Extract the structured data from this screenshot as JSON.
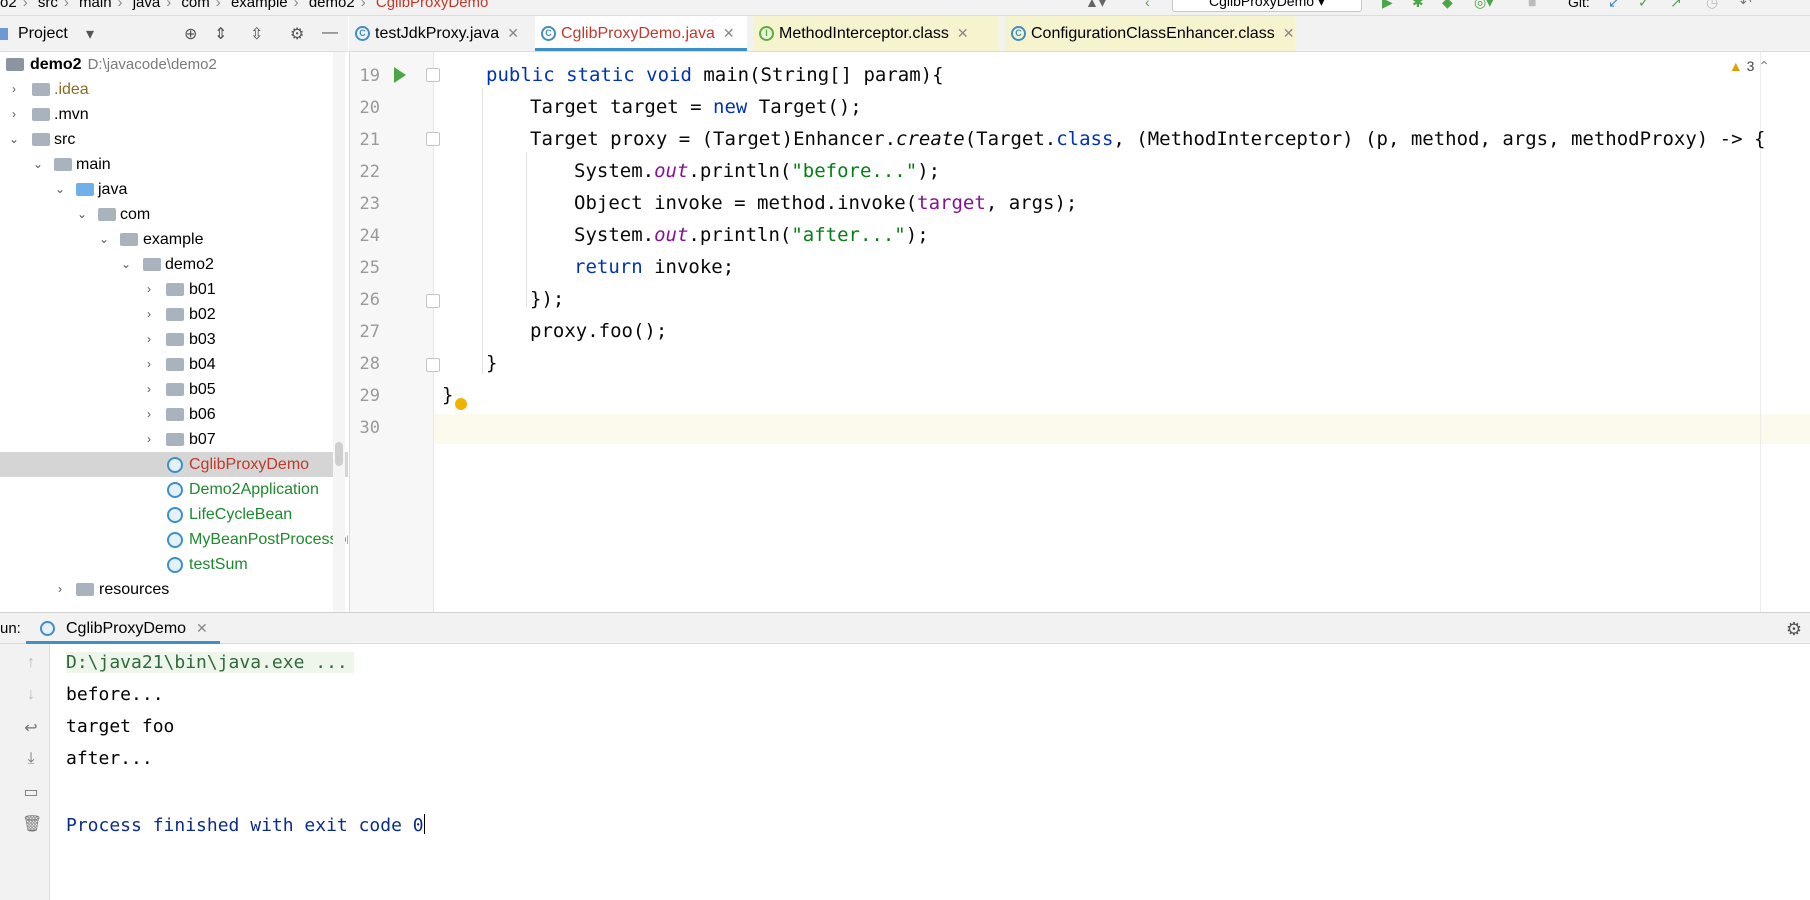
{
  "breadcrumb": {
    "items": [
      "o2",
      "src",
      "main",
      "java",
      "com",
      "example",
      "demo2"
    ],
    "current": "CglibProxyDemo"
  },
  "toolbar": {
    "run_config": "CglibProxyDemo",
    "git_label": "Git:"
  },
  "project_panel": {
    "title": "Project"
  },
  "tabs": [
    {
      "label": "testJdkProxy.java"
    },
    {
      "label": "CglibProxyDemo.java"
    },
    {
      "label": "MethodInterceptor.class"
    },
    {
      "label": "ConfigurationClassEnhancer.class"
    }
  ],
  "tree": {
    "root_label": "demo2",
    "root_path": "D:\\javacode\\demo2",
    "idea": ".idea",
    "mvn": ".mvn",
    "src": "src",
    "main": "main",
    "java": "java",
    "com": "com",
    "example": "example",
    "demo2": "demo2",
    "packages": [
      "b01",
      "b02",
      "b03",
      "b04",
      "b05",
      "b06",
      "b07"
    ],
    "classes": [
      "CglibProxyDemo",
      "Demo2Application",
      "LifeCycleBean",
      "MyBeanPostProcessor",
      "testSum"
    ],
    "resources": "resources"
  },
  "editor": {
    "warnings": "3",
    "line_numbers": [
      "19",
      "20",
      "21",
      "22",
      "23",
      "24",
      "25",
      "26",
      "27",
      "28",
      "29",
      "30"
    ],
    "code": {
      "l19_kw": "public static void",
      "l19_rest": " main(String[] param){",
      "l20_a": "Target target = ",
      "l20_kw": "new",
      "l20_b": " Target();",
      "l21_a": "Target proxy = (Target)Enhancer.",
      "l21_create": "create",
      "l21_b": "(Target.",
      "l21_class": "class",
      "l21_c": ", (MethodInterceptor) (p, method, args, methodProxy) -> {",
      "l22_a": "System.",
      "l22_out": "out",
      "l22_b": ".println(",
      "l22_str": "\"before...\"",
      "l22_c": ");",
      "l23_a": "Object invoke = method.invoke(",
      "l23_target": "target",
      "l23_b": ", args);",
      "l24_a": "System.",
      "l24_out": "out",
      "l24_b": ".println(",
      "l24_str": "\"after...\"",
      "l24_c": ");",
      "l25_kw": "return",
      "l25_b": " invoke;",
      "l26": "});",
      "l27": "proxy.foo();",
      "l28": "}",
      "l29": "}"
    }
  },
  "run_panel": {
    "label": "un:",
    "tab_label": "CglibProxyDemo",
    "output": [
      "D:\\java21\\bin\\java.exe ...",
      "before...",
      "target foo",
      "after...",
      "Process finished with exit code 0"
    ]
  },
  "icons": {
    "accent": "#3d8fc7",
    "run_green": "#4ba647"
  }
}
